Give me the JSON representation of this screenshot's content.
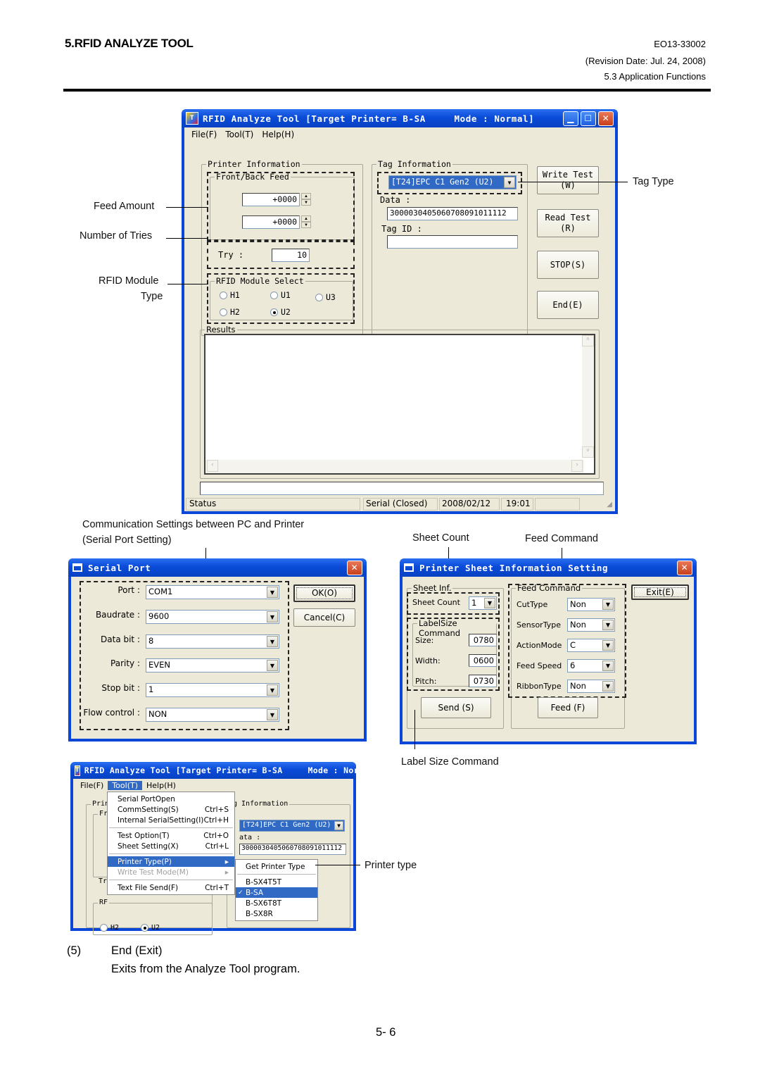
{
  "page_header": {
    "section_title": "5.RFID ANALYZE TOOL",
    "doc_number": "EO13-33002",
    "revision": "(Revision Date: Jul. 24, 2008)",
    "subsection": "5.3 Application Functions"
  },
  "main_window": {
    "title": "RFID Analyze Tool [Target Printer= B-SA     Mode : Normal]",
    "menu": [
      "File(F)",
      "Tool(T)",
      "Help(H)"
    ],
    "printer_info": {
      "label": "Printer Information",
      "front_back_feed_label": "Front/Back Feed",
      "feed_value_1": "+0000",
      "feed_value_2": "+0000",
      "try_label": "Try :",
      "try_value": "10",
      "module_select_label": "RFID Module Select",
      "modules": [
        {
          "label": "H1",
          "selected": false
        },
        {
          "label": "U1",
          "selected": false
        },
        {
          "label": "U3",
          "selected": false
        },
        {
          "label": "H2",
          "selected": false
        },
        {
          "label": "U2",
          "selected": true
        }
      ]
    },
    "tag_info": {
      "label": "Tag Information",
      "tag_type": "[T24]EPC C1 Gen2 (U2)",
      "data_label": "Data :",
      "data_value": "3000030405060708091011112",
      "tag_id_label": "Tag ID :",
      "tag_id_value": ""
    },
    "buttons": {
      "write_test": "Write Test",
      "write_test_key": "(W)",
      "read_test": "Read Test",
      "read_test_key": "(R)",
      "stop": "STOP(S)",
      "end": "End(E)"
    },
    "results_label": "Results",
    "results_text": "",
    "command_input": "",
    "statusbar": {
      "status": "Status",
      "serial": "Serial (Closed)",
      "date": "2008/02/12",
      "time": "19:01"
    }
  },
  "annotations": {
    "feed_amount": "Feed Amount",
    "number_of_tries": "Number of Tries",
    "rfid_module_type_1": "RFID Module",
    "rfid_module_type_2": "Type",
    "tag_type": "Tag Type",
    "comm_settings_1": "Communication Settings between PC and Printer",
    "comm_settings_2": "(Serial Port Setting)",
    "sheet_count": "Sheet Count",
    "feed_command": "Feed Command",
    "label_size_command": "Label Size Command",
    "printer_type": "Printer type"
  },
  "serial_port_dialog": {
    "title": "Serial Port",
    "fields": [
      {
        "label": "Port :",
        "value": "COM1"
      },
      {
        "label": "Baudrate :",
        "value": "9600"
      },
      {
        "label": "Data bit :",
        "value": "8"
      },
      {
        "label": "Parity :",
        "value": "EVEN"
      },
      {
        "label": "Stop bit :",
        "value": "1"
      },
      {
        "label": "Flow control :",
        "value": "NON"
      }
    ],
    "ok_label": "OK(O)",
    "cancel_label": "Cancel(C)"
  },
  "sheet_dialog": {
    "title": "Printer Sheet Information Setting",
    "sheet_inf_label": "Sheet Inf.",
    "sheet_count_label": "Sheet Count",
    "sheet_count_value": "1",
    "label_size_label": "LabelSize Command",
    "size_label": "Size:",
    "size_value": "0780",
    "width_label": "Width:",
    "width_value": "0600",
    "pitch_label": "Pitch:",
    "pitch_value": "0730",
    "send_label": "Send (S)",
    "feed_command_label": "Feed Command",
    "feed_fields": [
      {
        "label": "CutType",
        "value": "Non"
      },
      {
        "label": "SensorType",
        "value": "Non"
      },
      {
        "label": "ActionMode",
        "value": "C"
      },
      {
        "label": "Feed Speed",
        "value": "6"
      },
      {
        "label": "RibbonType",
        "value": "Non"
      }
    ],
    "feed_button_label": "Feed (F)",
    "exit_label": "Exit(E)"
  },
  "menu_window": {
    "title": "RFID Analyze Tool [Target Printer= B-SA     Mode : Normal]",
    "menu": [
      "File(F)",
      "Tool(T)",
      "Help(H)"
    ],
    "bg_labels": {
      "printer_info": "Prin",
      "front": "Fr",
      "tag_info": "g Information",
      "tag_type": "[T24]EPC C1 Gen2 (U2)",
      "data": "ata :",
      "data_value": "3000030405060708091011112",
      "try": "Tr",
      "rf": "RF",
      "h2": "H2",
      "u2": "U2"
    },
    "tool_menu": [
      {
        "label": "Serial PortOpen",
        "shortcut": ""
      },
      {
        "label": "CommSetting(S)",
        "shortcut": "Ctrl+S"
      },
      {
        "label": "Internal SerialSetting(I)",
        "shortcut": "Ctrl+H"
      },
      {
        "label": "Test Option(T)",
        "shortcut": "Ctrl+O"
      },
      {
        "label": "Sheet Setting(X)",
        "shortcut": "Ctrl+L"
      },
      {
        "label": "Printer Type(P)",
        "shortcut": "▸"
      },
      {
        "label": "Write Test Mode(M)",
        "shortcut": "▸"
      },
      {
        "label": "Text File Send(F)",
        "shortcut": "Ctrl+T"
      }
    ],
    "printer_type_submenu": [
      {
        "label": "Get Printer Type",
        "checked": false
      },
      {
        "label": "B-SX4T5T",
        "checked": false
      },
      {
        "label": "B-SA",
        "checked": true
      },
      {
        "label": "B-SX6T8T",
        "checked": false
      },
      {
        "label": "B-SX8R",
        "checked": false
      }
    ]
  },
  "section": {
    "number": "(5)",
    "heading": "End (Exit)",
    "description": "Exits from the Analyze Tool program."
  },
  "page_number": "5- 6"
}
